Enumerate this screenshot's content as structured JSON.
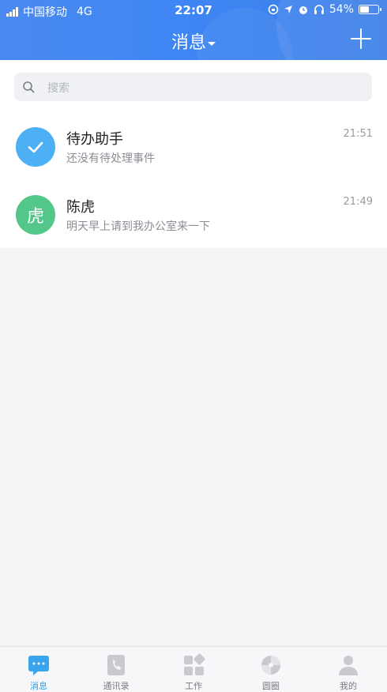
{
  "status_bar": {
    "carrier": "中国移动",
    "network": "4G",
    "time": "22:07",
    "battery": "54%",
    "battery_level": 0.54
  },
  "header": {
    "title": "消息",
    "add_icon": "plus-icon"
  },
  "search": {
    "placeholder": "搜索",
    "icon": "search-icon"
  },
  "messages": [
    {
      "name": "待办助手",
      "preview": "还没有待处理事件",
      "time": "21:51",
      "avatar_icon": "checkmark-icon",
      "avatar_color": "#4eb0f4"
    },
    {
      "name": "陈虎",
      "preview": "明天早上请到我办公室来一下",
      "time": "21:49",
      "avatar_text": "虎",
      "avatar_color": "#53c68a"
    }
  ],
  "tabbar": {
    "items": [
      {
        "label": "消息",
        "icon": "chat-bubble-icon",
        "active": true
      },
      {
        "label": "通讯录",
        "icon": "phone-book-icon",
        "active": false
      },
      {
        "label": "工作",
        "icon": "grid-icon",
        "active": false
      },
      {
        "label": "圆圈",
        "icon": "circle-swirl-icon",
        "active": false
      },
      {
        "label": "我的",
        "icon": "person-icon",
        "active": false
      }
    ]
  },
  "colors": {
    "header_blue": "#3f86f5",
    "active_tab": "#2f9ee8"
  }
}
